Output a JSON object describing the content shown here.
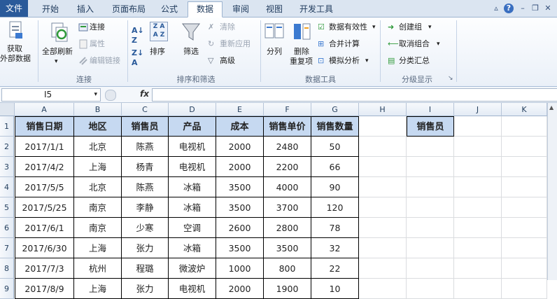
{
  "tabs": [
    "文件",
    "开始",
    "插入",
    "页面布局",
    "公式",
    "数据",
    "审阅",
    "视图",
    "开发工具"
  ],
  "active_tab": "数据",
  "ribbon": {
    "get_external": [
      "获取",
      "外部数据"
    ],
    "refresh_all": "全部刷新",
    "connections": "连接",
    "properties": "属性",
    "edit_links": "编辑链接",
    "group_connections": "连接",
    "sort": "排序",
    "filter": "筛选",
    "clear": "清除",
    "reapply": "重新应用",
    "advanced": "高级",
    "group_sort_filter": "排序和筛选",
    "text_to_columns": "分列",
    "remove_duplicates": [
      "删除",
      "重复项"
    ],
    "data_validation": "数据有效性",
    "consolidate": "合并计算",
    "what_if": "模拟分析",
    "group_data_tools": "数据工具",
    "group": "创建组",
    "ungroup": "取消组合",
    "subtotal": "分类汇总",
    "group_outline": "分级显示"
  },
  "formula_bar": {
    "name_box": "I5",
    "fx": "fx",
    "value": ""
  },
  "columns": [
    "A",
    "B",
    "C",
    "D",
    "E",
    "F",
    "G",
    "H",
    "I",
    "J",
    "K"
  ],
  "rows": [
    "1",
    "2",
    "3",
    "4",
    "5",
    "6",
    "7",
    "8",
    "9"
  ],
  "table": {
    "headers": [
      "销售日期",
      "地区",
      "销售员",
      "产品",
      "成本",
      "销售单价",
      "销售数量"
    ],
    "rows": [
      [
        "2017/1/1",
        "北京",
        "陈燕",
        "电视机",
        "2000",
        "2480",
        "50"
      ],
      [
        "2017/4/2",
        "上海",
        "杨青",
        "电视机",
        "2000",
        "2200",
        "66"
      ],
      [
        "2017/5/5",
        "北京",
        "陈燕",
        "冰箱",
        "3500",
        "4000",
        "90"
      ],
      [
        "2017/5/25",
        "南京",
        "李静",
        "冰箱",
        "3500",
        "3700",
        "120"
      ],
      [
        "2017/6/1",
        "南京",
        "少寒",
        "空调",
        "2600",
        "2800",
        "78"
      ],
      [
        "2017/6/30",
        "上海",
        "张力",
        "冰箱",
        "3500",
        "3500",
        "32"
      ],
      [
        "2017/7/3",
        "杭州",
        "程璐",
        "微波炉",
        "1000",
        "800",
        "22"
      ],
      [
        "2017/8/9",
        "上海",
        "张力",
        "电视机",
        "2000",
        "1900",
        "10"
      ]
    ]
  },
  "side_header": "销售员",
  "colors": {
    "header_fill": "#c6d9f1",
    "file_tab": "#2a5a9a"
  }
}
